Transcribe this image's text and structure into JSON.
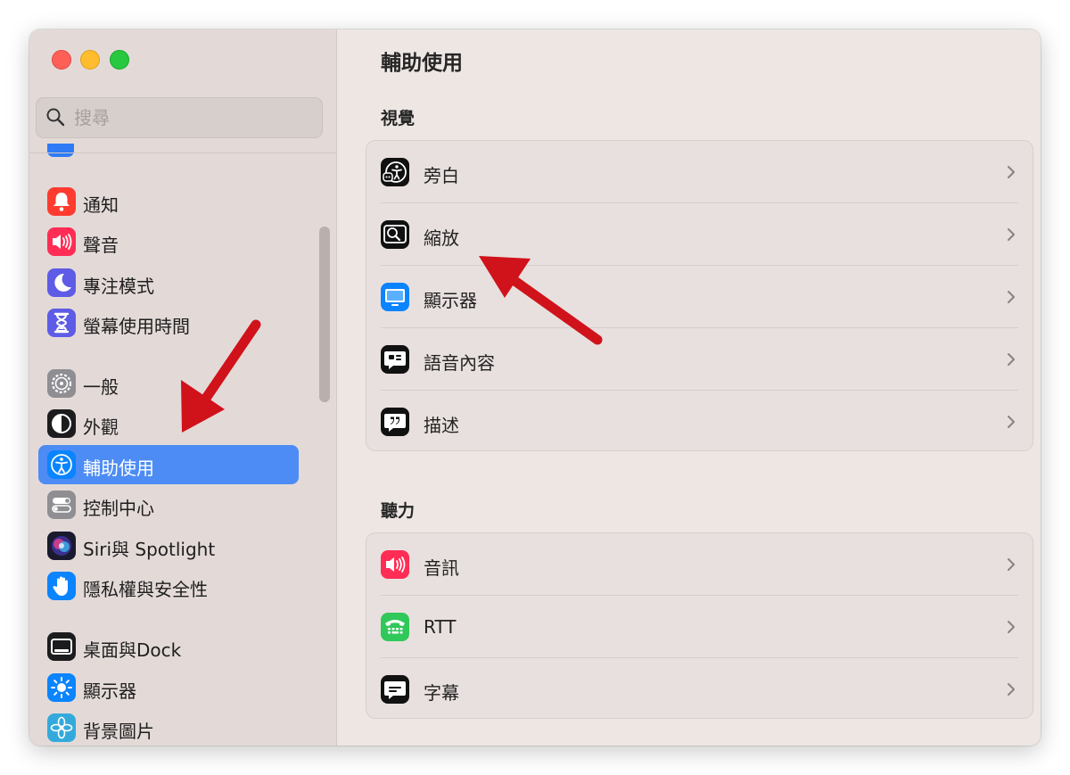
{
  "window": {
    "traffic_lights": [
      "close",
      "minimize",
      "zoom"
    ]
  },
  "sidebar": {
    "search": {
      "placeholder": "搜尋",
      "value": ""
    },
    "items": [
      {
        "label": "通知",
        "icon": "bell-icon",
        "color": "#ff3b30"
      },
      {
        "label": "聲音",
        "icon": "speaker-icon",
        "color": "#ff2d55"
      },
      {
        "label": "專注模式",
        "icon": "moon-icon",
        "color": "#5e5ce6"
      },
      {
        "label": "螢幕使用時間",
        "icon": "hourglass-icon",
        "color": "#5e5ce6"
      },
      {
        "label": "一般",
        "icon": "gear-icon",
        "color": "#8e8e93"
      },
      {
        "label": "外觀",
        "icon": "appearance-icon",
        "color": "#1c1c1e"
      },
      {
        "label": "輔助使用",
        "icon": "accessibility-icon",
        "color": "#0a84ff",
        "selected": true
      },
      {
        "label": "控制中心",
        "icon": "toggles-icon",
        "color": "#8e8e93"
      },
      {
        "label": "Siri與 Spotlight",
        "icon": "siri-icon",
        "color": "#6b4cd0"
      },
      {
        "label": "隱私權與安全性",
        "icon": "hand-icon",
        "color": "#0a84ff"
      },
      {
        "label": "桌面與Dock",
        "icon": "dock-icon",
        "color": "#1c1c1e"
      },
      {
        "label": "顯示器",
        "icon": "brightness-icon",
        "color": "#0a84ff"
      },
      {
        "label": "背景圖片",
        "icon": "flower-icon",
        "color": "#34aadc"
      }
    ]
  },
  "main": {
    "title": "輔助使用",
    "sections": [
      {
        "title": "視覺",
        "rows": [
          {
            "label": "旁白",
            "icon": "voiceover-icon"
          },
          {
            "label": "縮放",
            "icon": "zoom-icon"
          },
          {
            "label": "顯示器",
            "icon": "display-icon"
          },
          {
            "label": "語音內容",
            "icon": "spoken-content-icon"
          },
          {
            "label": "描述",
            "icon": "descriptions-icon"
          }
        ]
      },
      {
        "title": "聽力",
        "rows": [
          {
            "label": "音訊",
            "icon": "audio-icon"
          },
          {
            "label": "RTT",
            "icon": "rtt-icon"
          },
          {
            "label": "字幕",
            "icon": "captions-icon"
          }
        ]
      }
    ]
  },
  "colors": {
    "accent": "#4d8cf5",
    "annotation_arrow": "#d0121b"
  }
}
